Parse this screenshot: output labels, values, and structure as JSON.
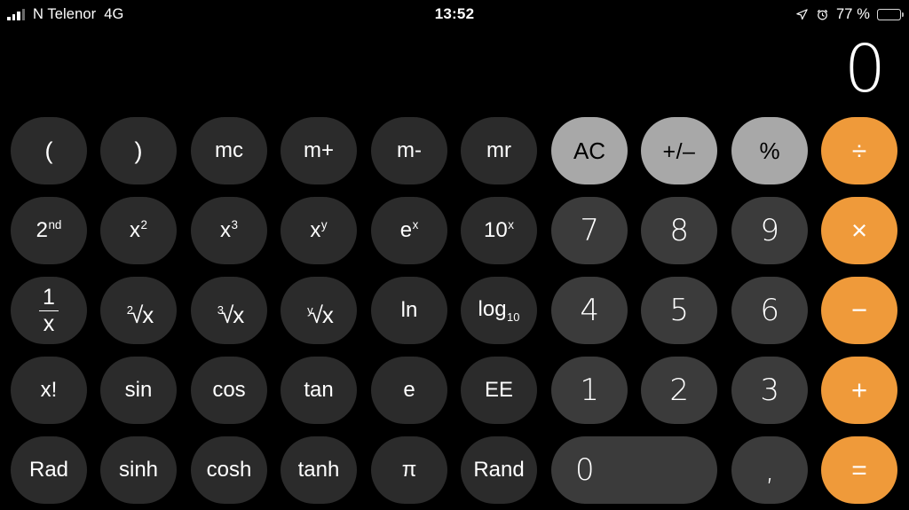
{
  "status_bar": {
    "carrier": "N Telenor",
    "network": "4G",
    "time": "13:52",
    "battery_percent": "77 %",
    "icons": [
      "signal-bars-icon",
      "location-arrow-icon",
      "alarm-clock-icon",
      "battery-icon"
    ]
  },
  "display": {
    "value": "0"
  },
  "colors": {
    "background": "#000000",
    "function_key": "#2b2b2b",
    "digit_key": "#3b3b3b",
    "utility_key": "#a8a8a8",
    "operator_key": "#ef9a3a",
    "text_light": "#ffffff",
    "text_dark": "#000000"
  },
  "keypad": {
    "rows": [
      [
        {
          "label": "(",
          "name": "open-paren-key",
          "kind": "fn"
        },
        {
          "label": ")",
          "name": "close-paren-key",
          "kind": "fn"
        },
        {
          "label": "mc",
          "name": "memory-clear-key",
          "kind": "fn"
        },
        {
          "label": "m+",
          "name": "memory-add-key",
          "kind": "fn"
        },
        {
          "label": "m-",
          "name": "memory-subtract-key",
          "kind": "fn"
        },
        {
          "label": "mr",
          "name": "memory-recall-key",
          "kind": "fn"
        },
        {
          "label": "AC",
          "name": "all-clear-key",
          "kind": "util"
        },
        {
          "label": "+/–",
          "name": "sign-toggle-key",
          "kind": "util"
        },
        {
          "label": "%",
          "name": "percent-key",
          "kind": "util"
        },
        {
          "label": "÷",
          "name": "divide-key",
          "kind": "op"
        }
      ],
      [
        {
          "label": "2nd",
          "name": "second-function-key",
          "kind": "fn"
        },
        {
          "label": "x2",
          "name": "square-key",
          "kind": "fn"
        },
        {
          "label": "x3",
          "name": "cube-key",
          "kind": "fn"
        },
        {
          "label": "xy",
          "name": "power-key",
          "kind": "fn"
        },
        {
          "label": "ex",
          "name": "exp-e-key",
          "kind": "fn"
        },
        {
          "label": "10x",
          "name": "exp-ten-key",
          "kind": "fn"
        },
        {
          "label": "7",
          "name": "digit-7-key",
          "kind": "digit"
        },
        {
          "label": "8",
          "name": "digit-8-key",
          "kind": "digit"
        },
        {
          "label": "9",
          "name": "digit-9-key",
          "kind": "digit"
        },
        {
          "label": "×",
          "name": "multiply-key",
          "kind": "op"
        }
      ],
      [
        {
          "label": "1/x",
          "name": "reciprocal-key",
          "kind": "fn"
        },
        {
          "label": "2√x",
          "name": "square-root-key",
          "kind": "fn"
        },
        {
          "label": "3√x",
          "name": "cube-root-key",
          "kind": "fn"
        },
        {
          "label": "y√x",
          "name": "nth-root-key",
          "kind": "fn"
        },
        {
          "label": "ln",
          "name": "natural-log-key",
          "kind": "fn"
        },
        {
          "label": "log10",
          "name": "log-base-10-key",
          "kind": "fn"
        },
        {
          "label": "4",
          "name": "digit-4-key",
          "kind": "digit"
        },
        {
          "label": "5",
          "name": "digit-5-key",
          "kind": "digit"
        },
        {
          "label": "6",
          "name": "digit-6-key",
          "kind": "digit"
        },
        {
          "label": "−",
          "name": "subtract-key",
          "kind": "op"
        }
      ],
      [
        {
          "label": "x!",
          "name": "factorial-key",
          "kind": "fn"
        },
        {
          "label": "sin",
          "name": "sine-key",
          "kind": "fn"
        },
        {
          "label": "cos",
          "name": "cosine-key",
          "kind": "fn"
        },
        {
          "label": "tan",
          "name": "tangent-key",
          "kind": "fn"
        },
        {
          "label": "e",
          "name": "euler-constant-key",
          "kind": "fn"
        },
        {
          "label": "EE",
          "name": "scientific-notation-key",
          "kind": "fn"
        },
        {
          "label": "1",
          "name": "digit-1-key",
          "kind": "digit"
        },
        {
          "label": "2",
          "name": "digit-2-key",
          "kind": "digit"
        },
        {
          "label": "3",
          "name": "digit-3-key",
          "kind": "digit"
        },
        {
          "label": "+",
          "name": "add-key",
          "kind": "op"
        }
      ],
      [
        {
          "label": "Rad",
          "name": "radian-mode-key",
          "kind": "fn"
        },
        {
          "label": "sinh",
          "name": "hyperbolic-sine-key",
          "kind": "fn"
        },
        {
          "label": "cosh",
          "name": "hyperbolic-cosine-key",
          "kind": "fn"
        },
        {
          "label": "tanh",
          "name": "hyperbolic-tangent-key",
          "kind": "fn"
        },
        {
          "label": "π",
          "name": "pi-key",
          "kind": "fn"
        },
        {
          "label": "Rand",
          "name": "random-key",
          "kind": "fn"
        },
        {
          "label": "0",
          "name": "digit-0-key",
          "kind": "digit"
        },
        {
          "label": ",",
          "name": "decimal-separator-key",
          "kind": "digit"
        },
        {
          "label": "=",
          "name": "equals-key",
          "kind": "op"
        }
      ]
    ]
  }
}
